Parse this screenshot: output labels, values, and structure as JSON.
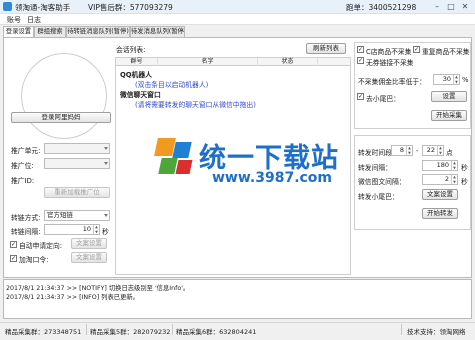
{
  "titlebar": {
    "title": "领淘通-淘客助手",
    "vip": "VIP售后群：577093279",
    "right": "跑单：3400521298",
    "minimize": "–",
    "maximize": "□",
    "close": "✕"
  },
  "menu": [
    "账号",
    "日志"
  ],
  "tabs": [
    "登录设置",
    "群组搜索",
    "待转链消息队列(暂停)",
    "待发消息队列(暂停)"
  ],
  "left": {
    "login_button": "登录阿里妈妈",
    "promo_unit_label": "推广单元:",
    "promo_position_label": "推广位:",
    "promo_id_label": "推广ID:",
    "reload_button": "重新加载推广位",
    "convert_mode_label": "转链方式:",
    "convert_mode_value": "官方短链",
    "convert_interval_label": "转链间隔:",
    "convert_interval_value": "10",
    "convert_interval_unit": "秒",
    "auto_apply_label": "自动申请定向:",
    "auto_apply_checked": true,
    "copy_setting_1": "文案设置",
    "add_tkl_label": "加淘口令:",
    "add_tkl_checked": true,
    "copy_setting_2": "文案设置"
  },
  "middle": {
    "combo_label": "会话列表:",
    "refresh_button": "刷新列表",
    "columns": [
      "群号",
      "名字",
      "状态"
    ],
    "rows": [
      {
        "text": "QQ机器人",
        "style": "bold"
      },
      {
        "text": "(双击条目以启动机器人)",
        "style": "blue"
      },
      {
        "text": "微信聊天窗口",
        "style": "bold"
      },
      {
        "text": "(请将需要转发的聊天窗口从微信中拖出)",
        "style": "blue"
      }
    ]
  },
  "right": {
    "c_store_label": "C店商品不采集",
    "c_store_checked": true,
    "dup_label": "重复商品不采集",
    "dup_checked": true,
    "no_link_label": "无券链接不采集",
    "no_link_checked": true,
    "commission_label": "不采集佣金比率低于：",
    "commission_value": "30",
    "commission_unit": "%",
    "tail_label": "去小尾巴：",
    "tail_checked": true,
    "settings_button": "设置",
    "start_collect_button": "开始采集",
    "forward_time_label": "转发时间段：",
    "time_from": "8",
    "time_sep": "-",
    "time_to": "22",
    "time_unit": "点",
    "forward_interval_label": "转发间隔：",
    "forward_interval_value": "180",
    "forward_interval_unit": "秒",
    "wx_interval_label": "微信图文间隔：",
    "wx_interval_value": "2",
    "wx_interval_unit": "秒",
    "forward_tail_label": "转发小尾巴：",
    "copy_setting_button": "文案设置",
    "start_forward_button": "开始转发"
  },
  "log": [
    "2017/8/1 21:34:37 >> [NOTIFY] 切换日志级别至 '信息Info'。",
    "2017/8/1 21:34:37 >> [INFO] 列表已更新。"
  ],
  "status": {
    "elite_collect": "精品采集群：273348751",
    "elite_collect5": "精品采集5群：282079232",
    "elite_collect6": "精品采集6群：632804241",
    "support": "技术支持：领淘网络"
  },
  "watermark": {
    "text": "统一下载站",
    "url": "www.3987.com"
  }
}
